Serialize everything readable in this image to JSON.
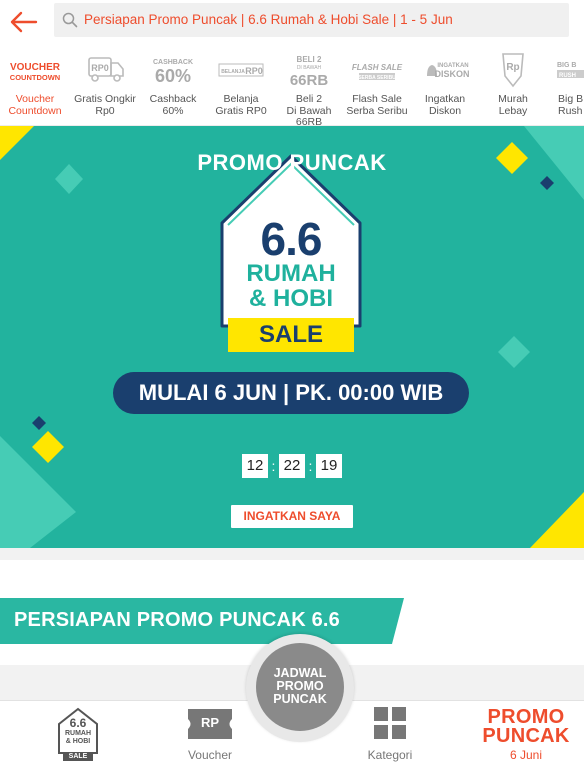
{
  "header": {
    "search_text": "Persiapan Promo Puncak | 6.6 Rumah & Hobi Sale | 1 - 5 Jun"
  },
  "categories": [
    {
      "icon_text": "VOUCHER COUNTDOWN",
      "label1": "Voucher",
      "label2": "Countdown",
      "icon": "voucher-countdown-icon"
    },
    {
      "icon_text": "RP0",
      "label1": "Gratis Ongkir",
      "label2": "Rp0",
      "icon": "free-shipping-truck-icon"
    },
    {
      "icon_text_small": "CASHBACK",
      "icon_text": "60%",
      "label1": "Cashback",
      "label2": "60%",
      "icon": "cashback-icon"
    },
    {
      "icon_text_small": "BELANJA GRATIS",
      "icon_text": "RP0",
      "label1": "Belanja",
      "label2": "Gratis RP0",
      "icon": "free-shopping-icon"
    },
    {
      "icon_text_small": "BELI 2 DI BAWAH",
      "icon_text": "66RB",
      "label1": "Beli 2",
      "label2": "Di Bawah 66RB",
      "icon": "buy2-icon"
    },
    {
      "icon_text_small": "FLASH SALE",
      "icon_text": "SERBA SERIBU",
      "label1": "Flash Sale",
      "label2": "Serba Seribu",
      "icon": "flash-sale-icon"
    },
    {
      "icon_text_small": "INGATKAN",
      "icon_text": "DISKON",
      "label1": "Ingatkan",
      "label2": "Diskon",
      "icon": "bell-discount-icon"
    },
    {
      "icon_text": "Rp",
      "label1": "Murah",
      "label2": "Lebay",
      "icon": "price-tag-icon"
    },
    {
      "icon_text_small": "BIG B",
      "icon_text": "RUSH",
      "label1": "Big B",
      "label2": "Rush",
      "icon": "big-brand-icon"
    }
  ],
  "banner": {
    "kicker": "PROMO PUNCAK",
    "logo_number": "6.6",
    "logo_line1": "RUMAH",
    "logo_line2": "& HOBI",
    "sale_label": "SALE",
    "schedule": "MULAI 6 JUN | PK. 00:00 WIB",
    "countdown": {
      "hours": "12",
      "minutes": "22",
      "seconds": "19",
      "separator": ":"
    },
    "remind_button": "INGATKAN SAYA",
    "colors": {
      "background": "#22b39e",
      "navy": "#1a3f6e",
      "yellow": "#ffe600"
    }
  },
  "section": {
    "title": "PERSIAPAN PROMO PUNCAK 6.6"
  },
  "bottom_nav": {
    "home_logo": {
      "number": "6.6",
      "line1": "RUMAH",
      "line2": "& HOBI",
      "sale": "SALE"
    },
    "voucher_icon_text": "RP",
    "voucher_label": "Voucher",
    "center_line1": "JADWAL",
    "center_line2": "PROMO",
    "center_line3": "PUNCAK",
    "category_label": "Kategori",
    "promo_line1": "PROMO",
    "promo_line2": "PUNCAK",
    "promo_date": "6 Juni"
  },
  "accent_color": "#ee4d2d"
}
